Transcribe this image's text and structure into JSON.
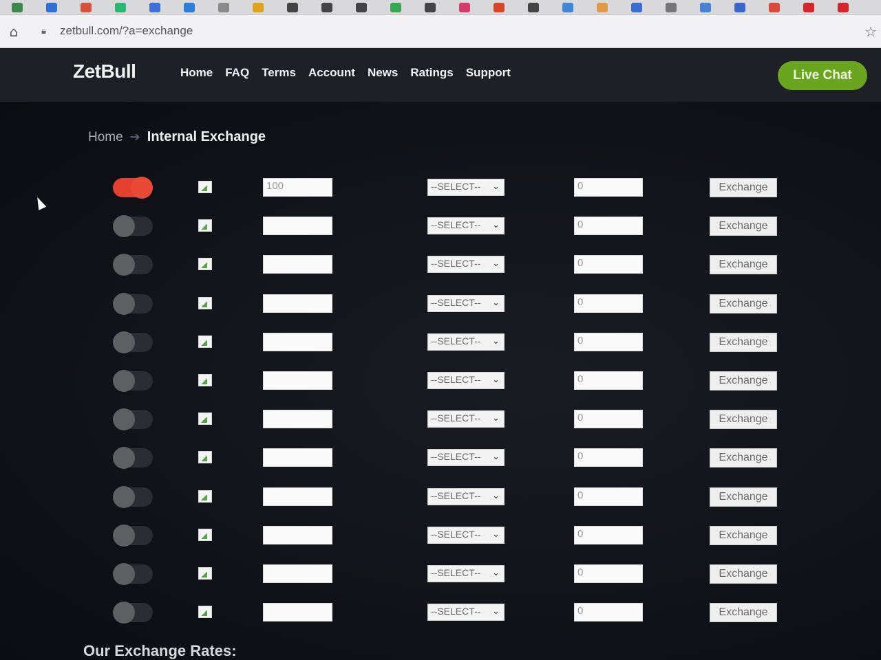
{
  "browser": {
    "url": "zetbull.com/?a=exchange",
    "bookmark_colors": [
      "#3a8a4b",
      "#2e6fd1",
      "#d6513b",
      "#2bb673",
      "#3f6fd8",
      "#2c7dd6",
      "#8a8a8a",
      "#e0a21b",
      "#444",
      "#444",
      "#444",
      "#34a853",
      "#444",
      "#d43a6a",
      "#d9452b",
      "#444",
      "#3d86d8",
      "#e09a4a",
      "#3b6cd1",
      "#777",
      "#4a7fd6",
      "#3a66c9",
      "#d84a3a",
      "#d4262a",
      "#d4262a"
    ]
  },
  "header": {
    "logo": "ZetBull",
    "nav": [
      "Home",
      "FAQ",
      "Terms",
      "Account",
      "News",
      "Ratings",
      "Support"
    ],
    "live_chat": "Live Chat"
  },
  "breadcrumb": {
    "home": "Home",
    "current": "Internal Exchange"
  },
  "exchange_rows": [
    {
      "enabled": true,
      "amount": "100",
      "select": "--SELECT--",
      "result": "0",
      "button": "Exchange"
    },
    {
      "enabled": false,
      "amount": "",
      "select": "--SELECT--",
      "result": "0",
      "button": "Exchange"
    },
    {
      "enabled": false,
      "amount": "",
      "select": "--SELECT--",
      "result": "0",
      "button": "Exchange"
    },
    {
      "enabled": false,
      "amount": "",
      "select": "--SELECT--",
      "result": "0",
      "button": "Exchange"
    },
    {
      "enabled": false,
      "amount": "",
      "select": "--SELECT--",
      "result": "0",
      "button": "Exchange"
    },
    {
      "enabled": false,
      "amount": "",
      "select": "--SELECT--",
      "result": "0",
      "button": "Exchange"
    },
    {
      "enabled": false,
      "amount": "",
      "select": "--SELECT--",
      "result": "0",
      "button": "Exchange"
    },
    {
      "enabled": false,
      "amount": "",
      "select": "--SELECT--",
      "result": "0",
      "button": "Exchange"
    },
    {
      "enabled": false,
      "amount": "",
      "select": "--SELECT--",
      "result": "0",
      "button": "Exchange"
    },
    {
      "enabled": false,
      "amount": "",
      "select": "--SELECT--",
      "result": "0",
      "button": "Exchange"
    },
    {
      "enabled": false,
      "amount": "",
      "select": "--SELECT--",
      "result": "0",
      "button": "Exchange"
    },
    {
      "enabled": false,
      "amount": "",
      "select": "--SELECT--",
      "result": "0",
      "button": "Exchange"
    }
  ],
  "rates_heading": "Our Exchange Rates:"
}
